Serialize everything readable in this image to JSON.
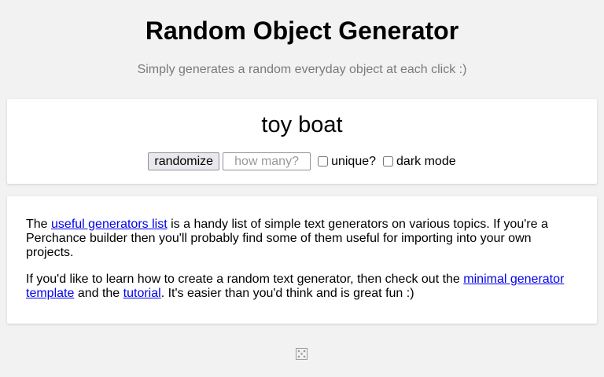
{
  "header": {
    "title": "Random Object Generator",
    "subtitle": "Simply generates a random everyday object at each click :)"
  },
  "generator": {
    "output": "toy boat",
    "randomize_label": "randomize",
    "count_placeholder": "how many?",
    "count_value": "",
    "unique_label": "unique?",
    "unique_checked": false,
    "dark_mode_label": "dark mode",
    "dark_mode_checked": false
  },
  "info": {
    "p1_before": "The ",
    "p1_link": "useful generators list",
    "p1_after": " is a handy list of simple text generators on various topics. If you're a Perchance builder then you'll probably find some of them useful for importing into your own projects.",
    "p2_before": "If you'd like to learn how to create a random text generator, then check out the ",
    "p2_link1": "minimal generator template",
    "p2_mid": " and the ",
    "p2_link2": "tutorial",
    "p2_after": ". It's easier than you'd think and is great fun :)"
  },
  "footer": {
    "icon": "dice-icon"
  },
  "colors": {
    "background": "#f2f2f2",
    "card": "#ffffff",
    "link": "#0000ee",
    "subtitle": "#7a7a7a"
  }
}
